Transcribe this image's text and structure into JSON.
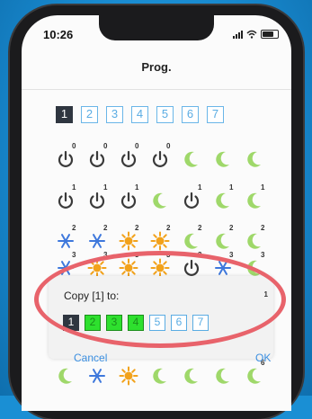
{
  "status": {
    "time": "10:26"
  },
  "header": {
    "title": "Prog."
  },
  "days": [
    "1",
    "2",
    "3",
    "4",
    "5",
    "6",
    "7"
  ],
  "active_day": "1",
  "grid": {
    "rows": [
      {
        "nums": [
          "0",
          "0",
          "0",
          "0",
          "",
          "",
          ""
        ],
        "icons": [
          "power",
          "power",
          "power",
          "power",
          "moon",
          "moon",
          "moon"
        ]
      },
      {
        "nums": [
          "1",
          "1",
          "1",
          "",
          "1",
          "1",
          "1"
        ],
        "icons": [
          "power",
          "power",
          "power",
          "moon",
          "power",
          "moon",
          "moon"
        ]
      },
      {
        "nums": [
          "2",
          "2",
          "2",
          "2",
          "2",
          "2",
          "2"
        ],
        "icons": [
          "snow",
          "snow",
          "sun",
          "sun",
          "moon",
          "moon",
          "moon"
        ]
      },
      {
        "nums": [
          "3",
          "3",
          "3",
          "3",
          "3",
          "3",
          "3"
        ],
        "icons": [
          "snow",
          "sun",
          "sun",
          "sun",
          "power",
          "snow",
          "moon"
        ]
      }
    ],
    "bottom_row": {
      "icons": [
        "moon",
        "snow",
        "sun",
        "moon",
        "moon",
        "moon",
        "moon"
      ],
      "nums": [
        "",
        "",
        "",
        "",
        "",
        "",
        "6"
      ]
    }
  },
  "dialog": {
    "title": "Copy [1] to:",
    "days": [
      {
        "label": "1",
        "state": "self"
      },
      {
        "label": "2",
        "state": "selected"
      },
      {
        "label": "3",
        "state": "selected"
      },
      {
        "label": "4",
        "state": "selected"
      },
      {
        "label": "5",
        "state": "unselected"
      },
      {
        "label": "6",
        "state": "unselected"
      },
      {
        "label": "7",
        "state": "unselected"
      }
    ],
    "cancel_label": "Cancel",
    "ok_label": "OK",
    "side_num": "1"
  },
  "colors": {
    "power": "#3a3a3a",
    "moon": "#9fd86a",
    "sun": "#f2a21b",
    "snow": "#3e78dc",
    "accent": "#5aace3",
    "selected_green": "#2ee02e",
    "highlight": "#e8636b"
  }
}
